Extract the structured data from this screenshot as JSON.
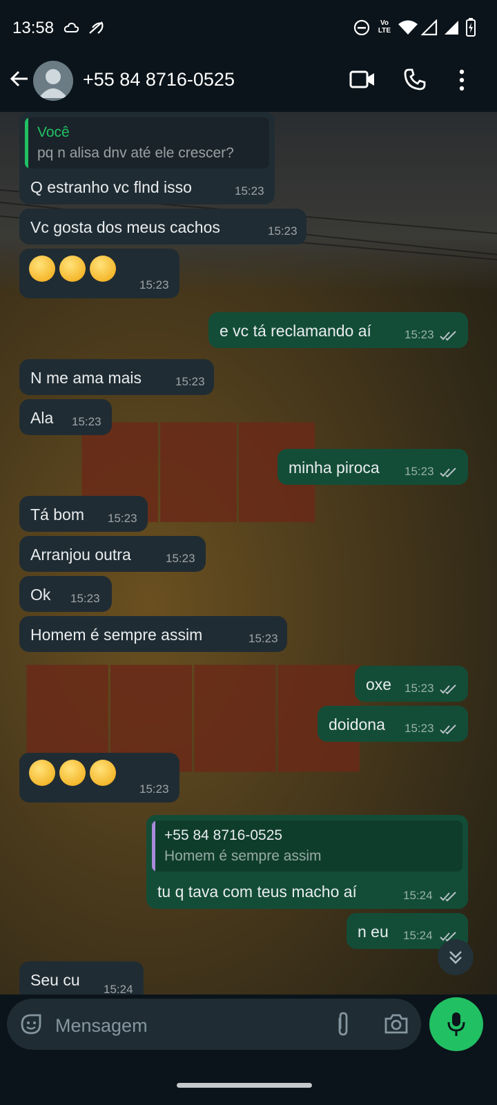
{
  "status_bar": {
    "time": "13:58",
    "lte_top": "Vo",
    "lte_bottom": "LTE"
  },
  "header": {
    "contact_name": "+55 84 8716-0525"
  },
  "colors": {
    "incoming": "#202c33",
    "outgoing": "#134d37",
    "accent_green": "#21c063",
    "quote_you": "#21c063",
    "quote_contact": "#a78bdb"
  },
  "messages": [
    {
      "dir": "in",
      "quote_name": "Você",
      "quote_text": "pq n alisa dnv até ele crescer?",
      "text": "Q estranho vc flnd isso",
      "time": "15:23"
    },
    {
      "dir": "in",
      "text": "Vc gosta dos meus cachos",
      "time": "15:23"
    },
    {
      "dir": "in",
      "emoji": "raised-eyebrow-face",
      "emoji_count": 3,
      "time": "15:23"
    },
    {
      "dir": "out",
      "text": "e vc tá reclamando aí",
      "time": "15:23"
    },
    {
      "dir": "in",
      "text": "N me ama mais",
      "time": "15:23"
    },
    {
      "dir": "in",
      "text": "Ala",
      "time": "15:23"
    },
    {
      "dir": "out",
      "text": "minha piroca",
      "time": "15:23"
    },
    {
      "dir": "in",
      "text": "Tá bom",
      "time": "15:23"
    },
    {
      "dir": "in",
      "text": "Arranjou outra",
      "time": "15:23"
    },
    {
      "dir": "in",
      "text": "Ok",
      "time": "15:23"
    },
    {
      "dir": "in",
      "text": "Homem é sempre assim",
      "time": "15:23"
    },
    {
      "dir": "out",
      "text": "oxe",
      "time": "15:23"
    },
    {
      "dir": "out",
      "text": "doidona",
      "time": "15:23"
    },
    {
      "dir": "in",
      "emoji": "rolling-eyes-face",
      "emoji_count": 3,
      "time": "15:23"
    },
    {
      "dir": "out",
      "quote_name": "+55 84 8716-0525",
      "quote_text": "Homem é sempre assim",
      "text": "tu q tava com teus macho aí",
      "time": "15:24"
    },
    {
      "dir": "out",
      "text": "n eu",
      "time": "15:24"
    },
    {
      "dir": "in",
      "text": "Seu cu",
      "time": "15:24"
    }
  ],
  "input": {
    "placeholder": "Mensagem"
  }
}
